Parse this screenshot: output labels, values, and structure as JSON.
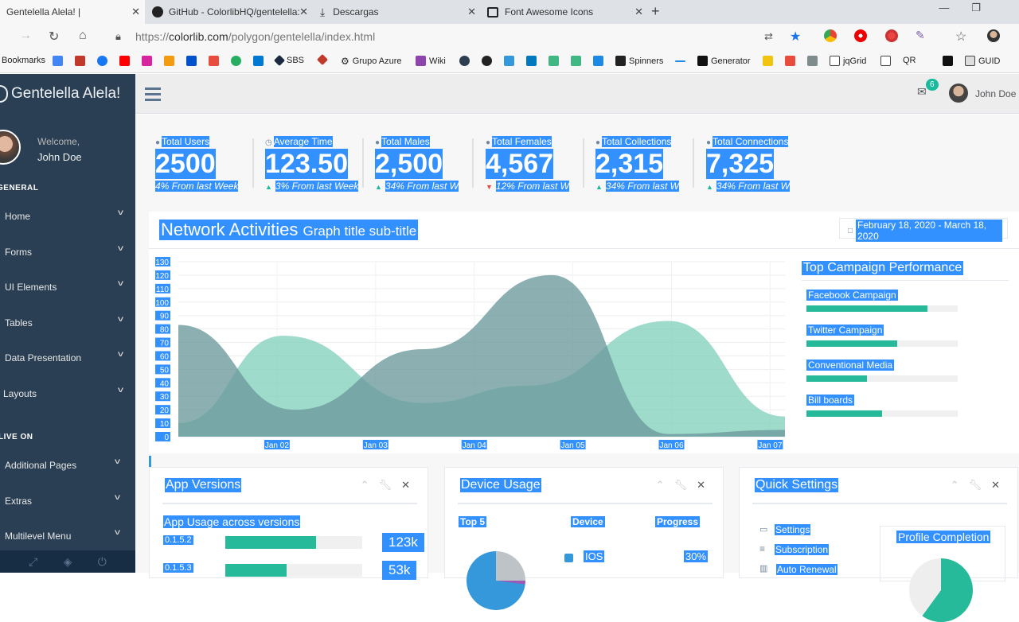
{
  "browser": {
    "tabs": [
      {
        "title": "Gentelella Alela! |",
        "active": true
      },
      {
        "title": "GitHub - ColorlibHQ/gentelella:",
        "active": false
      },
      {
        "title": "Descargas",
        "active": false
      },
      {
        "title": "Font Awesome Icons",
        "active": false
      }
    ],
    "url_scheme": "https://",
    "url_host": "colorlib.com",
    "url_path": "/polygon/gentelella/index.html",
    "bookmarks": [
      "Bookmarks",
      "SBS",
      "Grupo Azure",
      "Wiki",
      "Spinners",
      "Generator",
      "jqGrid",
      "QR",
      "GUID"
    ]
  },
  "sidebar": {
    "brand": "Gentelella Alela!",
    "welcome": "Welcome,",
    "user": "John Doe",
    "section_general": "GENERAL",
    "general_items": [
      "Home",
      "Forms",
      "UI Elements",
      "Tables",
      "Data Presentation",
      "Layouts"
    ],
    "section_live": "LIVE ON",
    "live_items": [
      "Additional Pages",
      "Extras",
      "Multilevel Menu"
    ]
  },
  "topnav": {
    "mail_count": "6",
    "user": "John Doe"
  },
  "tiles": [
    {
      "label": "Total Users",
      "count": "2500",
      "change": "4%",
      "suffix": " From last Week",
      "trend": "none"
    },
    {
      "label": "Average Time",
      "count": "123.50",
      "change": "3%",
      "suffix": " From last Week",
      "trend": "up"
    },
    {
      "label": "Total Males",
      "count": "2,500",
      "change": "34%",
      "suffix": " From last W",
      "trend": "up"
    },
    {
      "label": "Total Females",
      "count": "4,567",
      "change": "12%",
      "suffix": " From last W",
      "trend": "down"
    },
    {
      "label": "Total Collections",
      "count": "2,315",
      "change": "34%",
      "suffix": " From last W",
      "trend": "up"
    },
    {
      "label": "Total Connections",
      "count": "7,325",
      "change": "34%",
      "suffix": " From last W",
      "trend": "up"
    }
  ],
  "network": {
    "title": "Network Activities",
    "subtitle": "Graph title sub-title",
    "date_range": "February 18, 2020 - March 18, 2020"
  },
  "chart_data": {
    "type": "area",
    "categories": [
      "Jan 02",
      "Jan 03",
      "Jan 04",
      "Jan 05",
      "Jan 06",
      "Jan 07"
    ],
    "ylim": [
      0,
      130
    ],
    "yticks": [
      0,
      10,
      20,
      30,
      40,
      50,
      60,
      70,
      80,
      90,
      100,
      110,
      120,
      130
    ],
    "series": [
      {
        "color": "#7fcfba",
        "x": [
          0,
          0.9,
          2.1,
          3.0,
          4.2,
          5.2
        ],
        "values": [
          10,
          75,
          25,
          38,
          86,
          15
        ]
      },
      {
        "color": "#6c9a9c",
        "x": [
          0,
          1.0,
          2.1,
          3.2,
          4.2,
          5.2
        ],
        "values": [
          83,
          20,
          65,
          120,
          2,
          5
        ]
      }
    ]
  },
  "campaign": {
    "title": "Top Campaign Performance",
    "items": [
      {
        "label": "Facebook Campaign",
        "pct": 0.8
      },
      {
        "label": "Twitter Campaign",
        "pct": 0.6
      },
      {
        "label": "Conventional Media",
        "pct": 0.4
      },
      {
        "label": "Bill boards",
        "pct": 0.5
      }
    ]
  },
  "panels": {
    "app_versions": {
      "title": "App Versions",
      "subtitle": "App Usage across versions",
      "rows": [
        {
          "version": "0.1.5.2",
          "pct": 0.66,
          "value": "123k"
        },
        {
          "version": "0.1.5.3",
          "pct": 0.45,
          "value": "53k"
        }
      ]
    },
    "device_usage": {
      "title": "Device Usage",
      "headers": [
        "Top 5",
        "Device",
        "Progress"
      ],
      "rows": [
        {
          "device": "IOS",
          "progress": "30%"
        }
      ]
    },
    "quick_settings": {
      "title": "Quick Settings",
      "items": [
        "Settings",
        "Subscription",
        "Auto Renewal"
      ],
      "profile": "Profile Completion"
    }
  },
  "colors": {
    "sidebar": "#2a3f54",
    "accent": "#26b99a",
    "selection": "#3390ff"
  }
}
